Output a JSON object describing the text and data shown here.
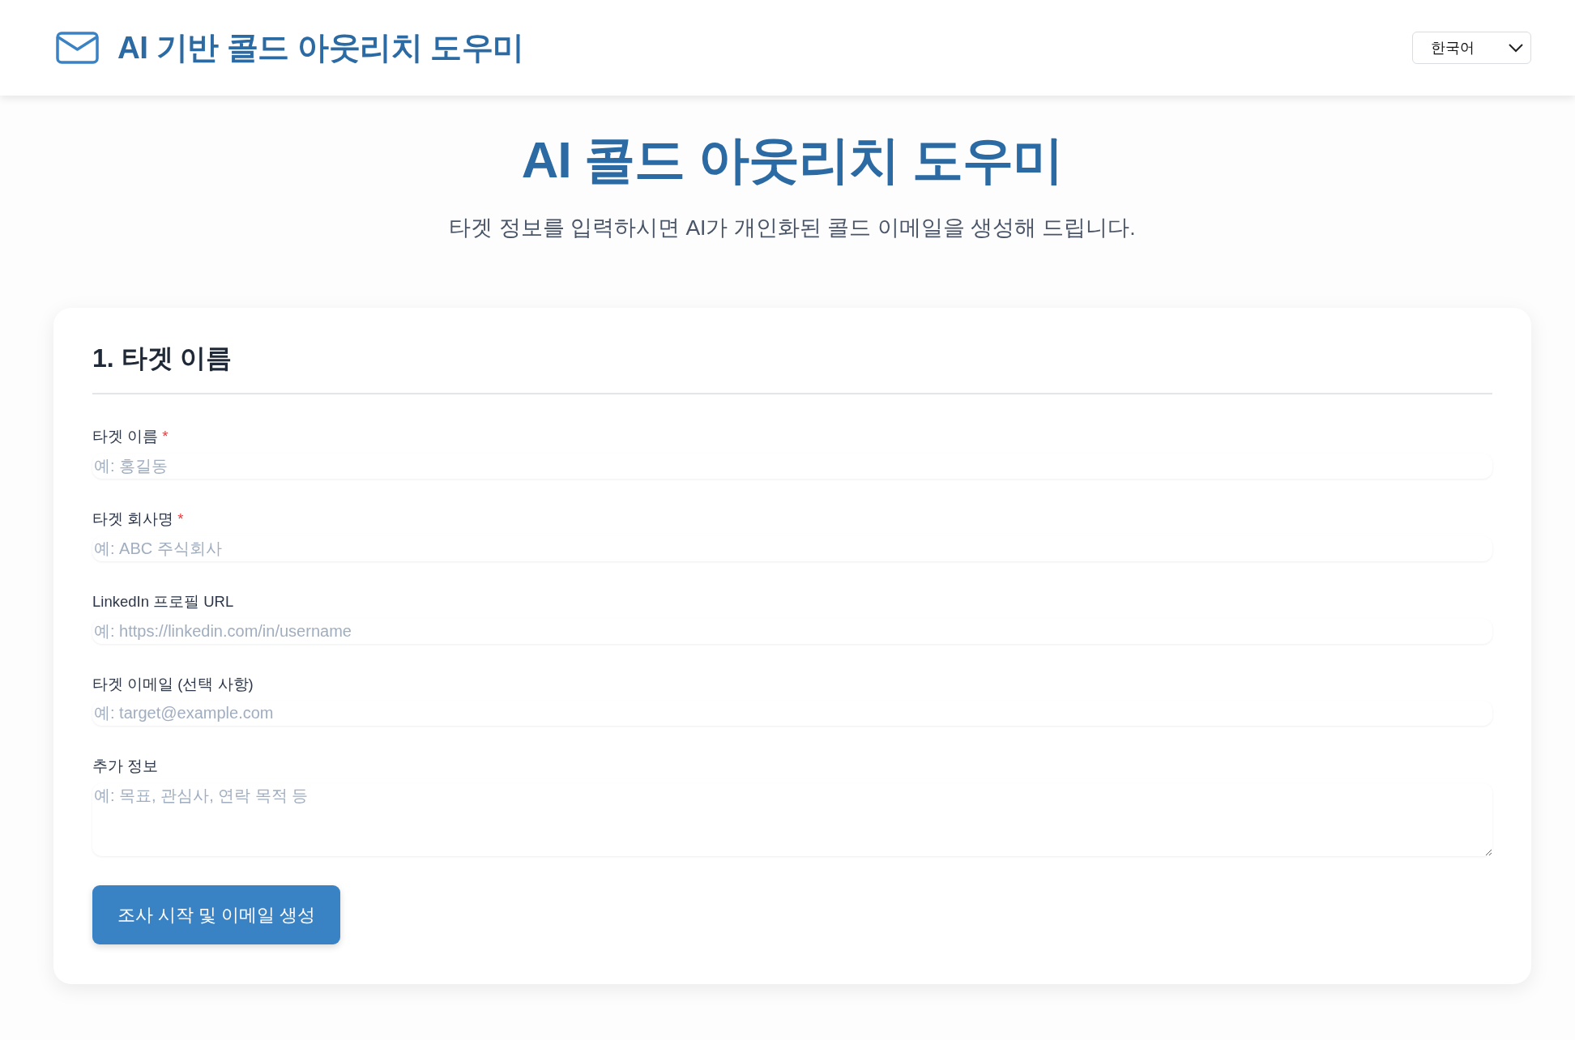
{
  "header": {
    "title": "AI 기반 콜드 아웃리치 도우미",
    "language_select": {
      "value": "한국어"
    }
  },
  "hero": {
    "title": "AI 콜드 아웃리치 도우미",
    "subtitle": "타겟 정보를 입력하시면 AI가 개인화된 콜드 이메일을 생성해 드립니다."
  },
  "form": {
    "heading": "1. 타겟 이름",
    "fields": [
      {
        "kind": "input",
        "label": "타겟 이름",
        "required_mark": "*",
        "placeholder": "예: 홍길동"
      },
      {
        "kind": "input",
        "label": "타겟 회사명",
        "required_mark": "*",
        "placeholder": "예: ABC 주식회사"
      },
      {
        "kind": "input",
        "label": "LinkedIn 프로필 URL",
        "placeholder": "예: https://linkedin.com/in/username"
      },
      {
        "kind": "input",
        "label": "타겟 이메일 (선택 사항)",
        "placeholder": "예: target@example.com"
      },
      {
        "kind": "textarea",
        "label": "추가 정보",
        "placeholder": "예: 목표, 관심사, 연락 목적 등"
      }
    ],
    "submit_button": "조사 시작 및 이메일 생성"
  }
}
